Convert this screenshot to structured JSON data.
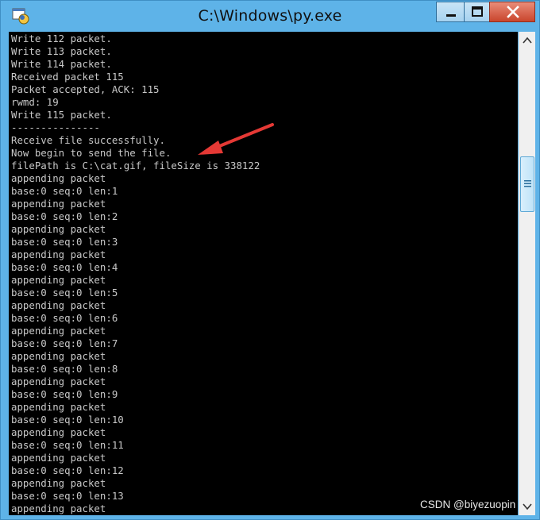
{
  "window": {
    "title": "C:\\Windows\\py.exe"
  },
  "console": {
    "lines": [
      "Write 112 packet.",
      "Write 113 packet.",
      "Write 114 packet.",
      "Received packet 115",
      "Packet accepted, ACK: 115",
      "rwmd: 19",
      "Write 115 packet.",
      "---------------",
      "Receive file successfully.",
      "Now begin to send the file.",
      "filePath is C:\\cat.gif, fileSize is 338122",
      "appending packet",
      "base:0 seq:0 len:1",
      "appending packet",
      "base:0 seq:0 len:2",
      "appending packet",
      "base:0 seq:0 len:3",
      "appending packet",
      "base:0 seq:0 len:4",
      "appending packet",
      "base:0 seq:0 len:5",
      "appending packet",
      "base:0 seq:0 len:6",
      "appending packet",
      "base:0 seq:0 len:7",
      "appending packet",
      "base:0 seq:0 len:8",
      "appending packet",
      "base:0 seq:0 len:9",
      "appending packet",
      "base:0 seq:0 len:10",
      "appending packet",
      "base:0 seq:0 len:11",
      "appending packet",
      "base:0 seq:0 len:12",
      "appending packet",
      "base:0 seq:0 len:13",
      "appending packet"
    ]
  },
  "watermark": "CSDN @biyezuopin",
  "icons": {
    "app": "python-console-icon",
    "minimize": "minimize-icon",
    "maximize": "maximize-icon",
    "close": "close-icon",
    "scroll_up": "chevron-up-icon",
    "scroll_down": "chevron-down-icon",
    "thumb_grip": "grip-lines-icon",
    "annotation": "red-arrow-annotation"
  },
  "colors": {
    "console_bg": "#000000",
    "console_text": "#c8c8c8",
    "frame": "#5eb3e8",
    "close_button": "#c9452c",
    "annotation": "#e53935"
  }
}
